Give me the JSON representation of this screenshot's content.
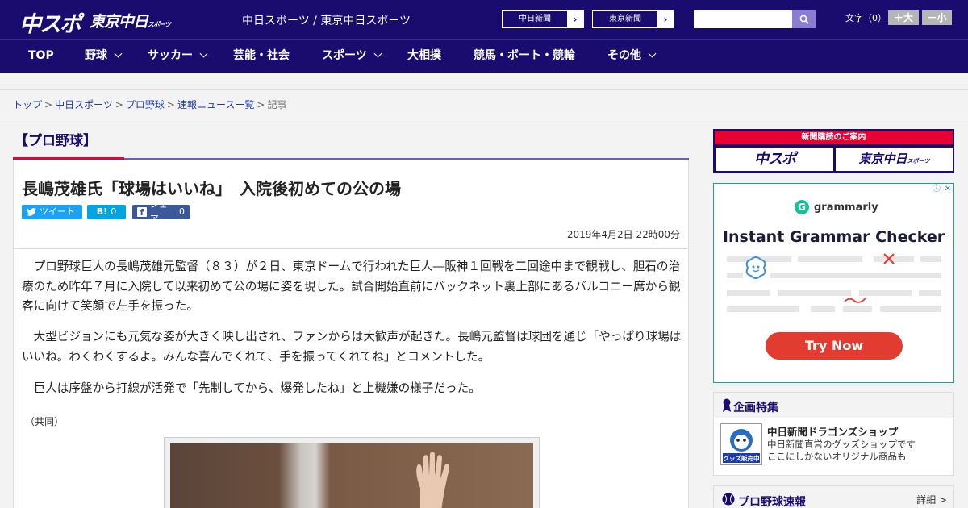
{
  "header": {
    "logo_main": "中スポ",
    "logo_tokyo": "東京中日",
    "logo_tokyo_small": "スポーツ",
    "site_names": "中日スポーツ / 東京中日スポーツ",
    "links": [
      {
        "label": "中日新聞",
        "arrow": "›"
      },
      {
        "label": "東京新聞",
        "arrow": "›"
      }
    ],
    "search_placeholder": "",
    "font_label": "文字（0）",
    "font_bigger": "＋大",
    "font_smaller": "－小"
  },
  "nav": {
    "items": [
      {
        "label": "TOP"
      },
      {
        "label": "野球"
      },
      {
        "label": "サッカー"
      },
      {
        "label": "芸能・社会"
      },
      {
        "label": "スポーツ"
      },
      {
        "label": "大相撲"
      },
      {
        "label": "競馬・ボート・競輪"
      },
      {
        "label": "その他"
      }
    ]
  },
  "breadcrumb": {
    "items": [
      "トップ",
      "中日スポーツ",
      "プロ野球",
      "速報ニュース一覧"
    ],
    "current": "記事",
    "separator": ">"
  },
  "article": {
    "category": "【プロ野球】",
    "headline": "長嶋茂雄氏「球場はいいね」　入院後初めての公の場",
    "share": {
      "tweet": "ツイート",
      "hatena_label": "B!",
      "hatena_count": "0",
      "fb_label": "シェア",
      "fb_count": "0"
    },
    "date": "2019年4月2日 22時00分",
    "paragraphs": [
      "プロ野球巨人の長嶋茂雄元監督（８３）が２日、東京ドームで行われた巨人―阪神１回戦を二回途中まで観戦し、胆石の治療のため昨年７月に入院して以来初めて公の場に姿を現した。試合開始直前にバックネット裏上部にあるバルコニー席から観客に向けて笑顔で左手を振った。",
      "大型ビジョンにも元気な姿が大きく映し出され、ファンからは大歓声が起きた。長嶋元監督は球団を通じ「やっぱり球場はいいね。わくわくするよ。みんな喜んでくれて、手を振ってくれてね」とコメントした。",
      "巨人は序盤から打線が活発で「先制してから、爆発したね」と上機嫌の様子だった。"
    ],
    "credit": "（共同）"
  },
  "sidebar": {
    "subscription": {
      "header": "新聞購読のご案内",
      "left": "中スポ",
      "right": "東京中日",
      "right_small": "スポーツ"
    },
    "ad": {
      "brand": "grammarly",
      "title": "Instant Grammar Checker",
      "cta": "Try Now",
      "info": "ⓘ",
      "close": "✕"
    },
    "features": {
      "title": "企画特集",
      "item_title": "中日新聞ドラゴンズショップ",
      "item_desc1": "中日新聞直営のグッズショップです",
      "item_desc2": "ここにしかないオリジナル商品も",
      "badge": "グッズ販売中"
    },
    "news": {
      "title": "プロ野球速報",
      "more": "詳細 >"
    }
  },
  "colors": {
    "brand_navy": "#1a0b6f",
    "accent_red": "#e60033",
    "twitter": "#1da1f2",
    "hatena": "#00a4de",
    "facebook": "#3b5998"
  }
}
